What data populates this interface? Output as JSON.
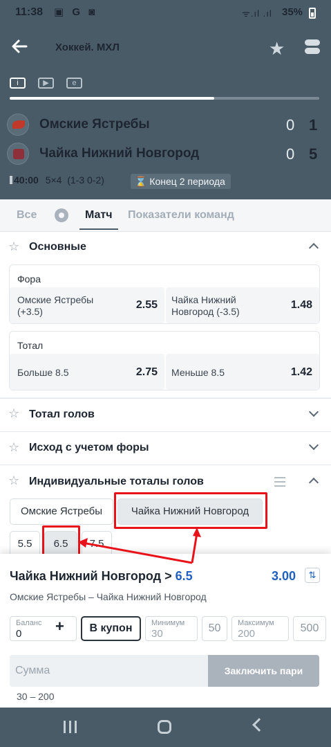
{
  "status_bar": {
    "time": "11:38",
    "apps": "▣ G ◙",
    "signal": "ᯤ.ıl .ıl",
    "battery": "35%"
  },
  "top_nav": {
    "title": "Хоккей. МХЛ"
  },
  "media_tabs": [
    "i",
    "▶",
    "e"
  ],
  "match_progress": 0.66,
  "teams": [
    {
      "name": "Омские Ястребы",
      "score_period": "0",
      "score_total": "1"
    },
    {
      "name": "Чайка Нижний Новгород",
      "score_period": "0",
      "score_total": "5"
    }
  ],
  "match_info": {
    "time": "40:00",
    "details": "5×4  (1-3 0-2)",
    "period": "⌛ Конец 2 периода"
  },
  "sub_tabs": {
    "all": "Все",
    "match": "Матч",
    "team_stats": "Показатели команд"
  },
  "sections": {
    "main": {
      "title": "Основные",
      "markets": [
        {
          "name": "Фора",
          "odds": [
            {
              "label_1": "Омские Ястребы",
              "label_2": "(+3.5)",
              "value": "2.55"
            },
            {
              "label_1": "Чайка Нижний",
              "label_2": "Новгород (-3.5)",
              "value": "1.48"
            }
          ]
        },
        {
          "name": "Тотал",
          "odds": [
            {
              "label_1": "Больше 8.5",
              "label_2": "",
              "value": "2.75"
            },
            {
              "label_1": "Меньше 8.5",
              "label_2": "",
              "value": "1.42"
            }
          ]
        }
      ]
    },
    "total_goals": {
      "title": "Тотал голов"
    },
    "handicap_result": {
      "title": "Исход с учетом форы"
    },
    "individual_totals": {
      "title": "Индивидуальные тоталы голов",
      "team_chips": [
        "Омские Ястребы",
        "Чайка Нижний Новгород"
      ],
      "total_chips": [
        "5.5",
        "6.5",
        "7.5"
      ]
    }
  },
  "betslip": {
    "selection_prefix": "Чайка Нижний Новгород >",
    "selection_value": "6.5",
    "odd": "3.00",
    "swap_icon": "⇅",
    "event": "Омские Ястребы – Чайка Нижний Новгород",
    "balance_label": "Баланс",
    "balance_value": "0",
    "plus": "+",
    "coupon_label": "В купон",
    "min_label": "Минимум",
    "min_value": "30",
    "quick_50": "50",
    "max_label": "Максимум",
    "max_value": "200",
    "quick_500": "500",
    "sum_placeholder": "Сумма",
    "place_bet_label": "Заключить пари",
    "range": "30 – 200"
  },
  "colors": {
    "header": "#4a5b68",
    "accent_blue": "#1f5fbf",
    "highlight_red": "#e8131a"
  }
}
